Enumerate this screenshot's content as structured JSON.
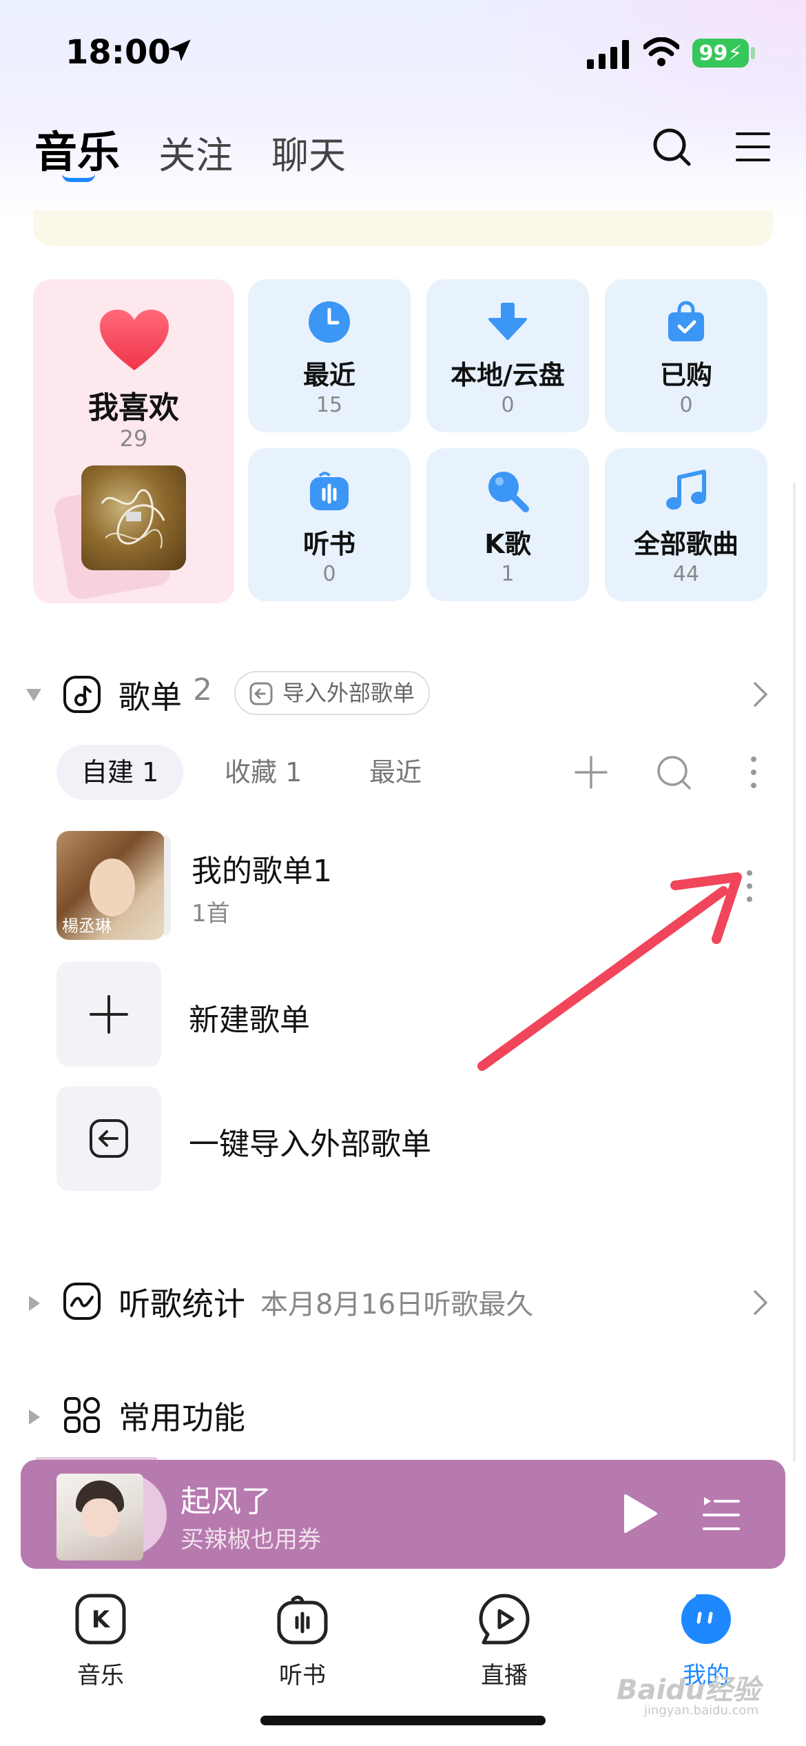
{
  "status_bar": {
    "time": "18:00",
    "battery": "99",
    "icons": [
      "location-arrow-icon",
      "cellular-signal-icon",
      "wifi-icon",
      "battery-charging-icon"
    ]
  },
  "header": {
    "tabs": [
      {
        "label": "音乐",
        "active": true
      },
      {
        "label": "关注",
        "active": false
      },
      {
        "label": "聊天",
        "active": false
      }
    ],
    "icons": [
      "search-icon",
      "menu-icon"
    ]
  },
  "quick_grid": {
    "favorite": {
      "label": "我喜欢",
      "count": "29"
    },
    "tiles": [
      {
        "label": "最近",
        "count": "15",
        "icon": "clock-icon"
      },
      {
        "label": "本地/云盘",
        "count": "0",
        "icon": "download-arrow-icon"
      },
      {
        "label": "已购",
        "count": "0",
        "icon": "shopping-bag-icon"
      },
      {
        "label": "听书",
        "count": "0",
        "icon": "audiobook-icon"
      },
      {
        "label": "K歌",
        "count": "1",
        "icon": "microphone-icon"
      },
      {
        "label": "全部歌曲",
        "count": "44",
        "icon": "music-note-icon"
      }
    ]
  },
  "playlists": {
    "title": "歌单",
    "count": "2",
    "import_button": "导入外部歌单",
    "tabs": [
      {
        "label": "自建 1",
        "active": true
      },
      {
        "label": "收藏 1",
        "active": false
      },
      {
        "label": "最近",
        "active": false
      }
    ],
    "items": [
      {
        "title": "我的歌单1",
        "subtitle": "1首",
        "cover_signature": "楊丞琳"
      }
    ],
    "actions": [
      {
        "label": "新建歌单",
        "icon": "plus-icon"
      },
      {
        "label": "一键导入外部歌单",
        "icon": "import-icon"
      }
    ]
  },
  "listening_stats": {
    "title": "听歌统计",
    "description": "本月8月16日听歌最久"
  },
  "common_functions": {
    "title": "常用功能"
  },
  "mini_player": {
    "title": "起风了",
    "subtitle": "买辣椒也用券"
  },
  "bottom_nav": [
    {
      "label": "音乐",
      "icon": "k-music-icon",
      "active": false
    },
    {
      "label": "听书",
      "icon": "audiobook-icon",
      "active": false
    },
    {
      "label": "直播",
      "icon": "live-play-icon",
      "active": false
    },
    {
      "label": "我的",
      "icon": "profile-icon",
      "active": true
    }
  ],
  "watermark": {
    "text": "Baidu经验",
    "sub": "jingyan.baidu.com"
  },
  "colors": {
    "accent": "#1e88ff",
    "favorite_card": "#fde8ee",
    "tile_bg": "#e8f2fd",
    "player_bg": "#b77aaf",
    "annotation_arrow": "#f0455a"
  }
}
